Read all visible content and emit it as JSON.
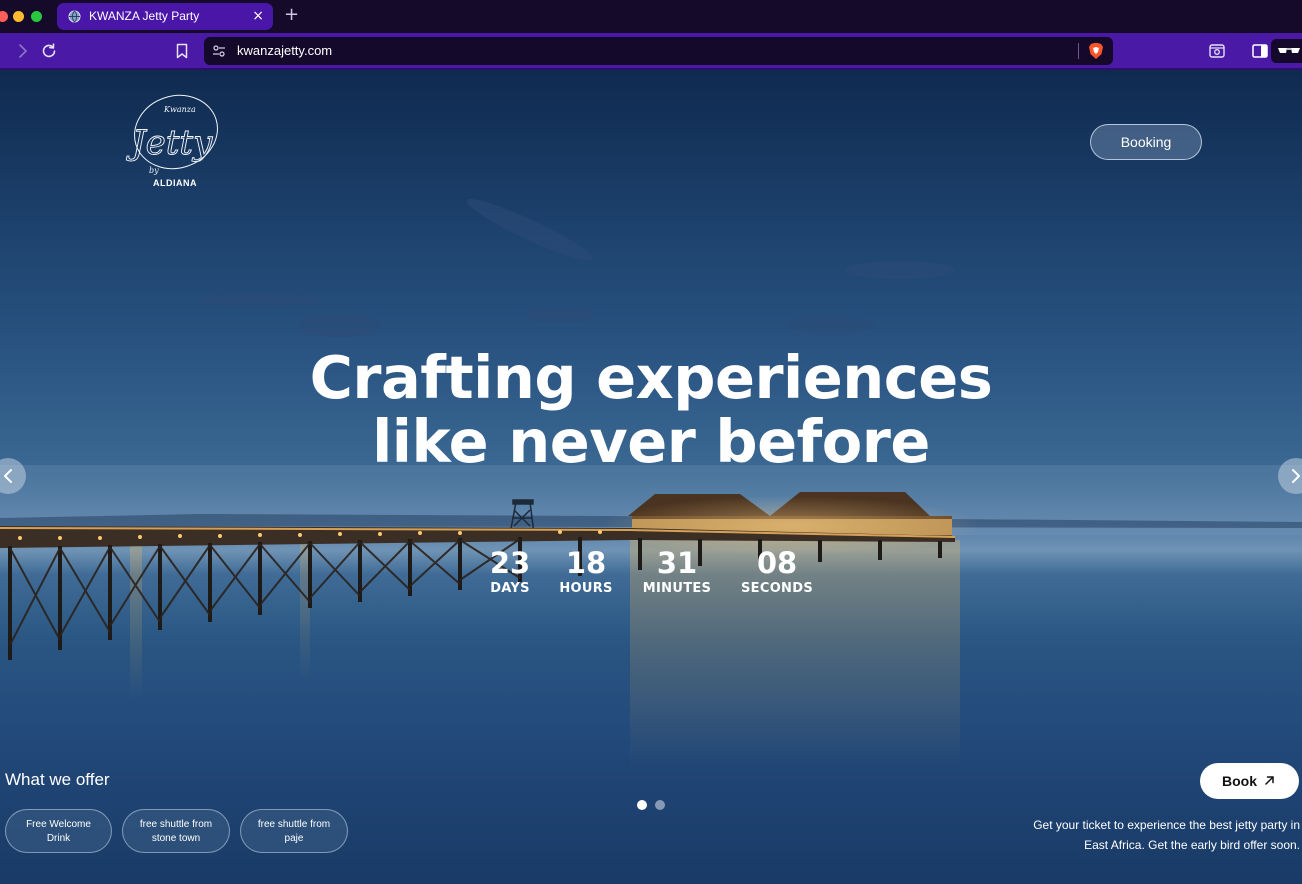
{
  "browser": {
    "tab_title": "KWANZA Jetty Party",
    "tab_close": "×",
    "new_tab": "+",
    "url": "kwanzajetty.com"
  },
  "logo": {
    "script_top": "Kwanza",
    "script_main": "Jetty",
    "by": "by",
    "brand": "ALDIANA"
  },
  "nav": {
    "booking_label": "Booking"
  },
  "hero": {
    "headline_line1": "Crafting experiences",
    "headline_line2": "like never before"
  },
  "countdown": [
    {
      "value": "23",
      "label": "DAYS"
    },
    {
      "value": "18",
      "label": "HOURS"
    },
    {
      "value": "31",
      "label": "MINUTES"
    },
    {
      "value": "08",
      "label": "SECONDS"
    }
  ],
  "carousel": {
    "slide_count": 2,
    "active_slide": 1
  },
  "offers": {
    "title": "What we offer",
    "items": [
      {
        "line1": "Free Welcome",
        "line2": "Drink"
      },
      {
        "line1": "free shuttle from",
        "line2": "stone town"
      },
      {
        "line1": "free shuttle from",
        "line2": "paje"
      }
    ]
  },
  "cta": {
    "book_label": "Book",
    "line1": "Get your ticket to experience the best jetty party in",
    "line2": "East Africa. Get the early bird offer soon."
  },
  "colors": {
    "tab_active": "#4a16a8",
    "toolbar": "#4a1aa6",
    "url_field": "#15092b",
    "brave_orange": "#fb542b"
  },
  "icons": [
    "globe-icon",
    "forward-icon",
    "reload-icon",
    "bookmark-icon",
    "site-settings-icon",
    "brave-shield-icon",
    "screenshot-icon",
    "sidebar-icon",
    "glasses-icon",
    "chevron-left-icon",
    "chevron-right-icon",
    "arrow-up-right-icon"
  ]
}
